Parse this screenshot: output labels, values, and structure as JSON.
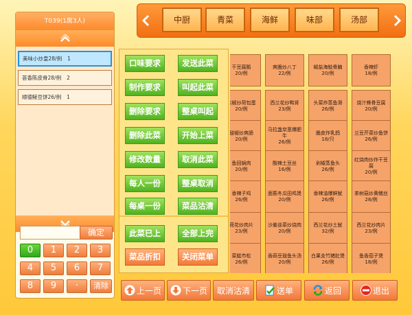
{
  "order": {
    "table_label": "T039(1席3人)",
    "items": [
      {
        "name": "美味小炒皇28/例",
        "qty": "1",
        "selected": true
      },
      {
        "name": "荟香陈皮骨28/例",
        "qty": "2",
        "selected": false
      },
      {
        "name": "顺德鲮豆饼26/例",
        "qty": "1",
        "selected": false
      }
    ],
    "qty_input": "",
    "keypad": {
      "confirm": "确定",
      "keys": [
        "0",
        "1",
        "2",
        "3",
        "4",
        "5",
        "6",
        "7",
        "8",
        "9",
        "·"
      ],
      "clear": "清除"
    }
  },
  "categories": {
    "tabs": [
      "中厨",
      "青菜",
      "海鲜",
      "味部",
      "汤部"
    ]
  },
  "actions": {
    "primary": [
      "口味要求",
      "发送此菜",
      "制作要求",
      "叫起此菜",
      "删除要求",
      "整桌叫起",
      "删除此菜",
      "开始上菜",
      "修改数量",
      "取消此菜",
      "每人一份",
      "整桌取消",
      "每桌一份",
      "菜品沽清"
    ],
    "secondary": [
      "此菜已上",
      "全部上完",
      "菜品折扣",
      "关闭菜单"
    ]
  },
  "dishes": [
    {
      "name": "干豆腐鹅",
      "price": "20/例"
    },
    {
      "name": "爽脆炒八丁",
      "price": "22/例"
    },
    {
      "name": "椒盐海鲶骨腩",
      "price": "20/例"
    },
    {
      "name": "香辣虾",
      "price": "18/例"
    },
    {
      "name": "尖椒炒荷包蛋",
      "price": "20/例"
    },
    {
      "name": "西兰花炒鸭肾",
      "price": "23/例"
    },
    {
      "name": "头菜炸蒸鱼滑",
      "price": "26/例"
    },
    {
      "name": "烧汁蜂骨豆腐",
      "price": "20/例"
    },
    {
      "name": "鼓椒炒爽肠",
      "price": "20/例"
    },
    {
      "name": "马拉盏京葱爆肥牛",
      "price": "26/例"
    },
    {
      "name": "脆皮炸乳鸽",
      "price": "18/只"
    },
    {
      "name": "兰豆芹菜炒鱼饼",
      "price": "26/例"
    },
    {
      "name": "鱼回锅肉",
      "price": "20/例"
    },
    {
      "name": "酸辣土豆丝",
      "price": "16/例"
    },
    {
      "name": "剁椒蒸鱼头",
      "price": "26/例"
    },
    {
      "name": "红烧肉炒炸干豆腐",
      "price": "20/例"
    },
    {
      "name": "香辣子鸡",
      "price": "26/例"
    },
    {
      "name": "面筋冬瓜田鸡煲",
      "price": "20/例"
    },
    {
      "name": "香辣油爆鲜鱿",
      "price": "26/例"
    },
    {
      "name": "茶树菇炒黄鳝丝",
      "price": "28/例"
    },
    {
      "name": "荷花炒肉片",
      "price": "23/例"
    },
    {
      "name": "沙姜韭菜炒烧肉",
      "price": "20/例"
    },
    {
      "name": "西兰花炒土鱿",
      "price": "32/例"
    },
    {
      "name": "西兰花炒肉片",
      "price": "23/例"
    },
    {
      "name": "菜蜓市松",
      "price": "26/例"
    },
    {
      "name": "香蒜豆鼓鱼头汤",
      "price": "20/例"
    },
    {
      "name": "白果支竹猪肚煲",
      "price": "26/例"
    },
    {
      "name": "鱼香茄子煲",
      "price": "18/例"
    }
  ],
  "bottom": {
    "prev_page": "上一页",
    "next_page": "下一页",
    "cancel_soldout": "取消沽清",
    "send_order": "送单",
    "back": "返回",
    "exit": "退出"
  },
  "colors": {
    "accent_orange": "#f27a36",
    "action_green": "#4fb21f",
    "selected_blue": "#2b8fd6",
    "dish_tile": "#f6a36a"
  }
}
